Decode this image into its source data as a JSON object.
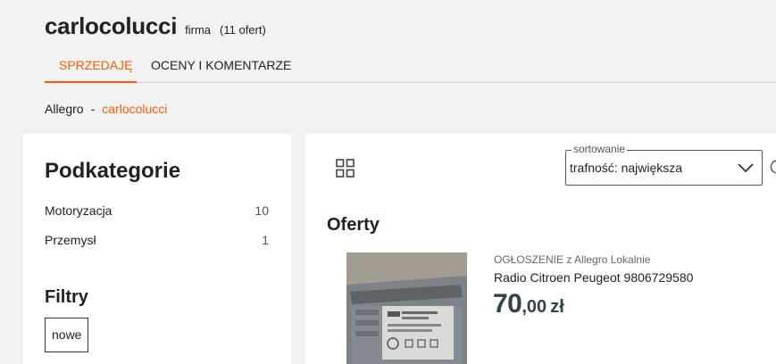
{
  "seller": {
    "name": "carlocolucci",
    "type": "firma",
    "count": "(11 ofert)"
  },
  "tabs": {
    "sell": "SPRZEDAJĘ",
    "ratings": "OCENY I KOMENTARZE"
  },
  "breadcrumb": {
    "root": "Allegro",
    "separator": "-",
    "current": "carlocolucci"
  },
  "sidebar": {
    "title": "Podkategorie",
    "categories": [
      {
        "label": "Motoryzacja",
        "count": "10"
      },
      {
        "label": "Przemysł",
        "count": "1"
      }
    ],
    "filters_title": "Filtry",
    "filter_chip": "nowe"
  },
  "sort": {
    "legend": "sortowanie",
    "value": "trafność: największa"
  },
  "offers": {
    "title": "Oferty",
    "items": [
      {
        "meta": "OGŁOSZENIE z Allegro Lokalnie",
        "title": "Radio Citroen Peugeot 9806729580",
        "price_int": "70",
        "price_dec": ",00",
        "currency": "zł"
      }
    ]
  },
  "icons": {
    "grid": "grid-view-icon",
    "chevron": "chevron-down-icon",
    "refresh": "refresh-icon"
  },
  "colors": {
    "accent": "#ff5a00",
    "price": "#36414a"
  }
}
